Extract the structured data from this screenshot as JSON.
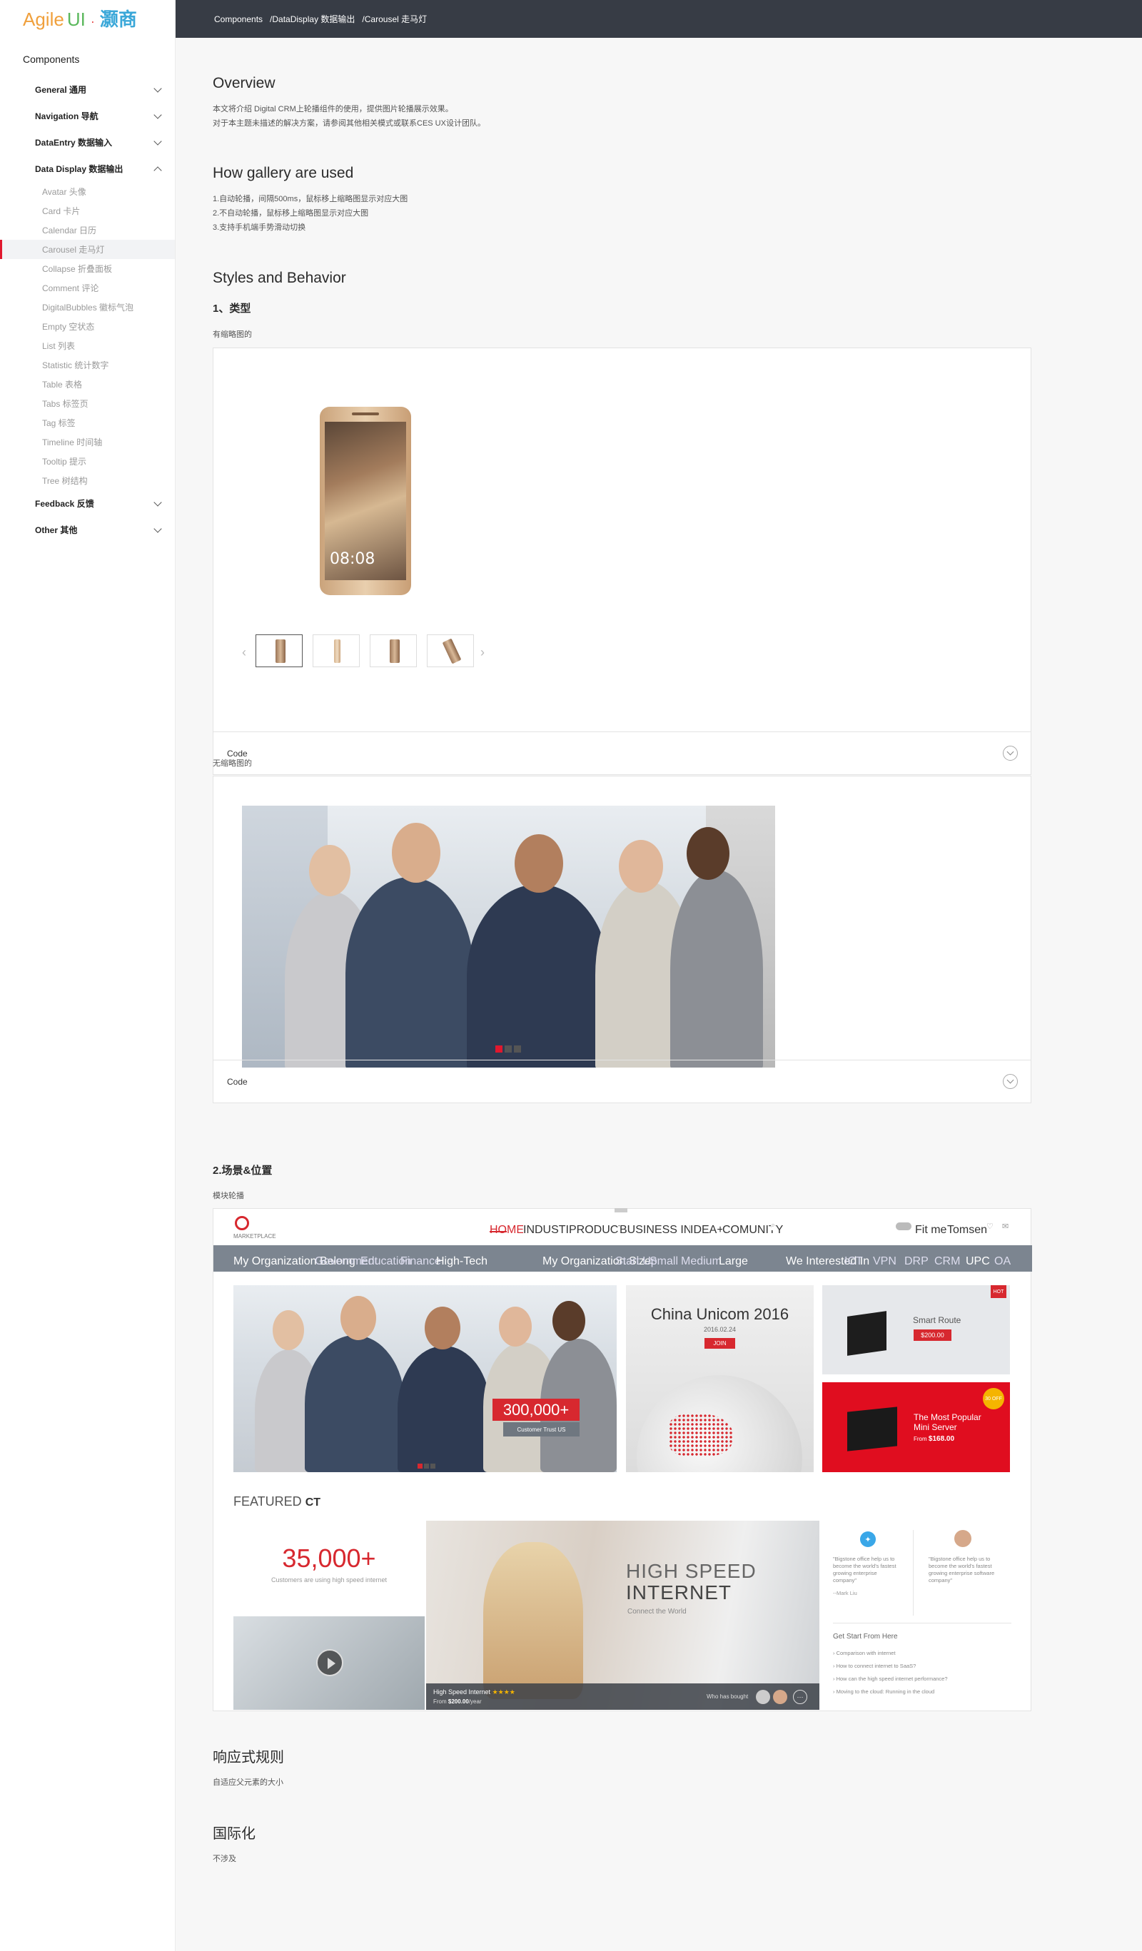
{
  "logo": {
    "agile": "Agile",
    "ui": "UI",
    "dot": "·",
    "cn": "灏商"
  },
  "sidebar": {
    "title": "Components",
    "groups": [
      {
        "label": "General 通用"
      },
      {
        "label": "Navigation 导航"
      },
      {
        "label": "DataEntry 数据输入"
      },
      {
        "label": "Data Display 数据输出"
      },
      {
        "label": "Feedback 反馈"
      },
      {
        "label": "Other 其他"
      }
    ],
    "items": [
      "Avatar 头像",
      "Card 卡片",
      "Calendar 日历",
      "Carousel 走马灯",
      "Collapse 折叠面板",
      "Comment 评论",
      "DigitalBubbles 徽标气泡",
      "Empty 空状态",
      "List 列表",
      "Statistic 统计数字",
      "Table 表格",
      "Tabs 标签页",
      "Tag 标签",
      "Timeline 时间轴",
      "Tooltip 提示",
      "Tree 树结构"
    ]
  },
  "breadcrumb": {
    "c1": "Components",
    "c2": "/DataDisplay 数据输出",
    "c3": "/Carousel 走马灯"
  },
  "overview": {
    "title": "Overview",
    "l1": "本文将介绍 Digital CRM上轮播组件的使用，提供图片轮播展示效果。",
    "l2": "对于本主题未描述的解决方案，请参阅其他相关模式或联系CES UX设计团队。"
  },
  "gallery": {
    "title": "How gallery are used",
    "l1": "1.自动轮播，间隔500ms，鼠标移上缩略图显示对应大图",
    "l2": "2.不自动轮播，鼠标移上缩略图显示对应大图",
    "l3": "3.支持手机端手势滑动切换"
  },
  "styles": {
    "title": "Styles and Behavior",
    "h1": "1、类型",
    "lbl1": "有缩略图的",
    "code1": "Code",
    "phone_time": "08:08",
    "lbl2": "无缩略图的",
    "code2": "Code",
    "h2": "2.场景&位置",
    "lbl3": "模块轮播"
  },
  "market": {
    "brand": "MARKETPLACE",
    "nav": [
      "HOME",
      "INDUSTIES",
      "PRODUCTS",
      "BUSINESS INSIGHT",
      "IDEA+",
      "COMUNITY"
    ],
    "fit": "Fit me",
    "user": "Tomsen",
    "bar_org": "My Organization Belong",
    "bar_org_opts": [
      "Government",
      "Education",
      "Finance",
      "High-Tech"
    ],
    "bar_size": "My Organization Size",
    "bar_size_opts": [
      "Start Up",
      "Small",
      "Medium",
      "Large"
    ],
    "bar_int": "We Interested In",
    "bar_int_opts": [
      "ICT",
      "VPN",
      "DRP",
      "CRM",
      "UPC",
      "OA"
    ],
    "big_num": "300,000+",
    "trust": "Customer Trust US",
    "cu_title": "China Unicom 2016",
    "cu_date": "2016.02.24",
    "cu_join": "JOIN",
    "hot": "HOT",
    "smart": "Smart Route",
    "smart_price": "$200.00",
    "popular1": "The Most Popular",
    "popular2": "Mini Server",
    "popular_from": "From",
    "popular_price": "$168.00",
    "badge2": "30 OFF",
    "featured": "FEATURED",
    "featured_ct": "CT",
    "n35": "35,000+",
    "n35_sub": "Customers are using high speed internet",
    "hs1": "HIGH SPEED",
    "hs2": "INTERNET",
    "hs3": "Connect the World",
    "hsi": "High Speed Internet",
    "stars": "★★★★",
    "from": "From",
    "hsi_price": "$200.00",
    "per_year": "/year",
    "who": "Who has bought",
    "q1": "\"Bigstone office help us to become the world's fastest growing enterprise company\"",
    "q1_by": "--Mark Liu",
    "q2": "\"Bigstone office help us to become the world's fastest growing enterprise software company\"",
    "gs": "Get Start From Here",
    "links": [
      "Comparison with internet",
      "How to connect internet to SaaS?",
      "How can the high speed internet performance?",
      "Moving to the cloud: Running in the cloud"
    ]
  },
  "responsive": {
    "title": "响应式规则",
    "text": "自适应父元素的大小"
  },
  "i18n": {
    "title": "国际化",
    "text": "不涉及"
  }
}
